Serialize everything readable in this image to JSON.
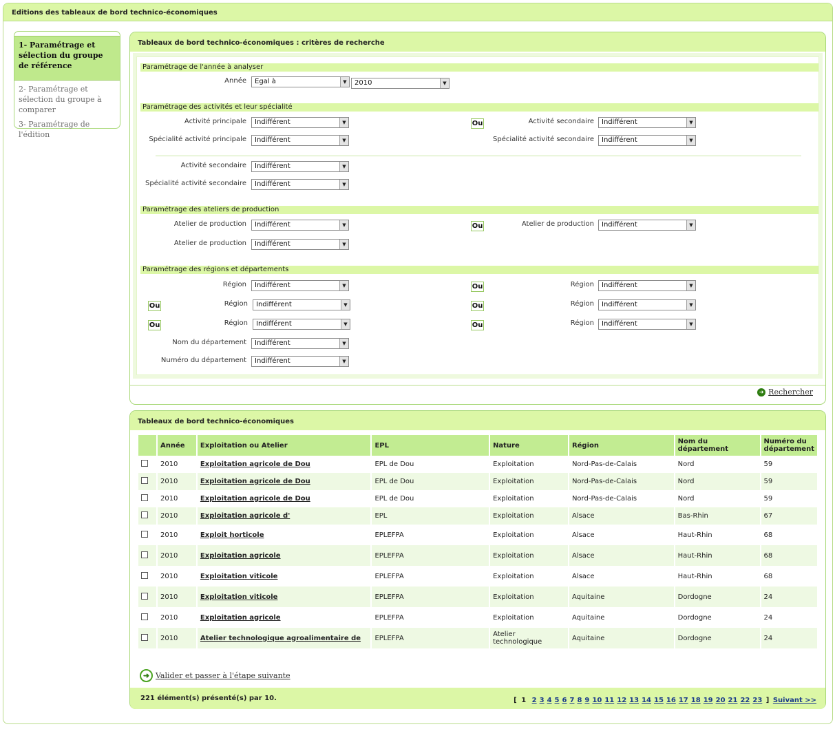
{
  "app_title": "Editions des tableaux de bord technico-économiques",
  "steps": [
    {
      "label": "1- Paramétrage et sélection du groupe de référence"
    },
    {
      "label": "2- Paramétrage et sélection du groupe à comparer"
    },
    {
      "label": "3- Paramétrage de l'édition"
    }
  ],
  "criteria": {
    "title": "Tableaux de bord technico-économiques : critères de recherche",
    "section_year": "Paramétrage de l'année à analyser",
    "year_label": "Année",
    "year_operator": "Egal à",
    "year_value": "2010",
    "section_activities": "Paramétrage des activités et leur spécialité",
    "lbl_activite_principale": "Activité principale",
    "lbl_specialite_principale": "Spécialité activité principale",
    "lbl_activite_secondaire": "Activité secondaire",
    "lbl_specialite_secondaire": "Spécialité activité secondaire",
    "section_ateliers": "Paramétrage des ateliers de production",
    "lbl_atelier": "Atelier de production",
    "section_regions": "Paramétrage des régions et départements",
    "lbl_region": "Région",
    "lbl_nom_departement": "Nom du département",
    "lbl_numero_departement": "Numéro du département",
    "default_value": "Indifférent",
    "ou_label": "Ou",
    "search_link": "Rechercher"
  },
  "results": {
    "title": "Tableaux de bord technico-économiques",
    "columns": [
      "Année",
      "Exploitation ou Atelier",
      "EPL",
      "Nature",
      "Région",
      "Nom du département",
      "Numéro du département"
    ],
    "rows": [
      {
        "annee": "2010",
        "nom": "Exploitation agricole de Dou",
        "epl": "EPL de Dou",
        "nature": "Exploitation",
        "region": "Nord-Pas-de-Calais",
        "dep": "Nord",
        "num": "59"
      },
      {
        "annee": "2010",
        "nom": "Exploitation agricole de Dou",
        "epl": "EPL de Dou",
        "nature": "Exploitation",
        "region": "Nord-Pas-de-Calais",
        "dep": "Nord",
        "num": "59"
      },
      {
        "annee": "2010",
        "nom": "Exploitation agricole de Dou",
        "epl": "EPL de Dou",
        "nature": "Exploitation",
        "region": "Nord-Pas-de-Calais",
        "dep": "Nord",
        "num": "59"
      },
      {
        "annee": "2010",
        "nom": "Exploitation agricole d'",
        "epl": "EPL",
        "nature": "Exploitation",
        "region": "Alsace",
        "dep": "Bas-Rhin",
        "num": "67"
      },
      {
        "annee": "2010",
        "nom": "Exploit horticole",
        "epl": "EPLEFPA",
        "nature": "Exploitation",
        "region": "Alsace",
        "dep": "Haut-Rhin",
        "num": "68"
      },
      {
        "annee": "2010",
        "nom": "Exploitation agricole",
        "epl": "EPLEFPA",
        "nature": "Exploitation",
        "region": "Alsace",
        "dep": "Haut-Rhin",
        "num": "68"
      },
      {
        "annee": "2010",
        "nom": "Exploitation viticole",
        "epl": "EPLEFPA",
        "nature": "Exploitation",
        "region": "Alsace",
        "dep": "Haut-Rhin",
        "num": "68"
      },
      {
        "annee": "2010",
        "nom": "Exploitation viticole",
        "epl": "EPLEFPA",
        "nature": "Exploitation",
        "region": "Aquitaine",
        "dep": "Dordogne",
        "num": "24"
      },
      {
        "annee": "2010",
        "nom": "Exploitation agricole",
        "epl": "EPLEFPA",
        "nature": "Exploitation",
        "region": "Aquitaine",
        "dep": "Dordogne",
        "num": "24"
      },
      {
        "annee": "2010",
        "nom": "Atelier technologique agroalimentaire de",
        "epl": "EPLEFPA",
        "nature": "Atelier technologique",
        "region": "Aquitaine",
        "dep": "Dordogne",
        "num": "24"
      }
    ],
    "validate_link": "Valider et passer à l'étape suivante",
    "count_text": "221 élément(s) présenté(s) par 10.",
    "pager": {
      "open": "[",
      "current": "1",
      "pages": [
        "2",
        "3",
        "4",
        "5",
        "6",
        "7",
        "8",
        "9",
        "10",
        "11",
        "12",
        "13",
        "14",
        "15",
        "16",
        "17",
        "18",
        "19",
        "20",
        "21",
        "22",
        "23"
      ],
      "close": "]",
      "next": "Suivant >>"
    }
  }
}
